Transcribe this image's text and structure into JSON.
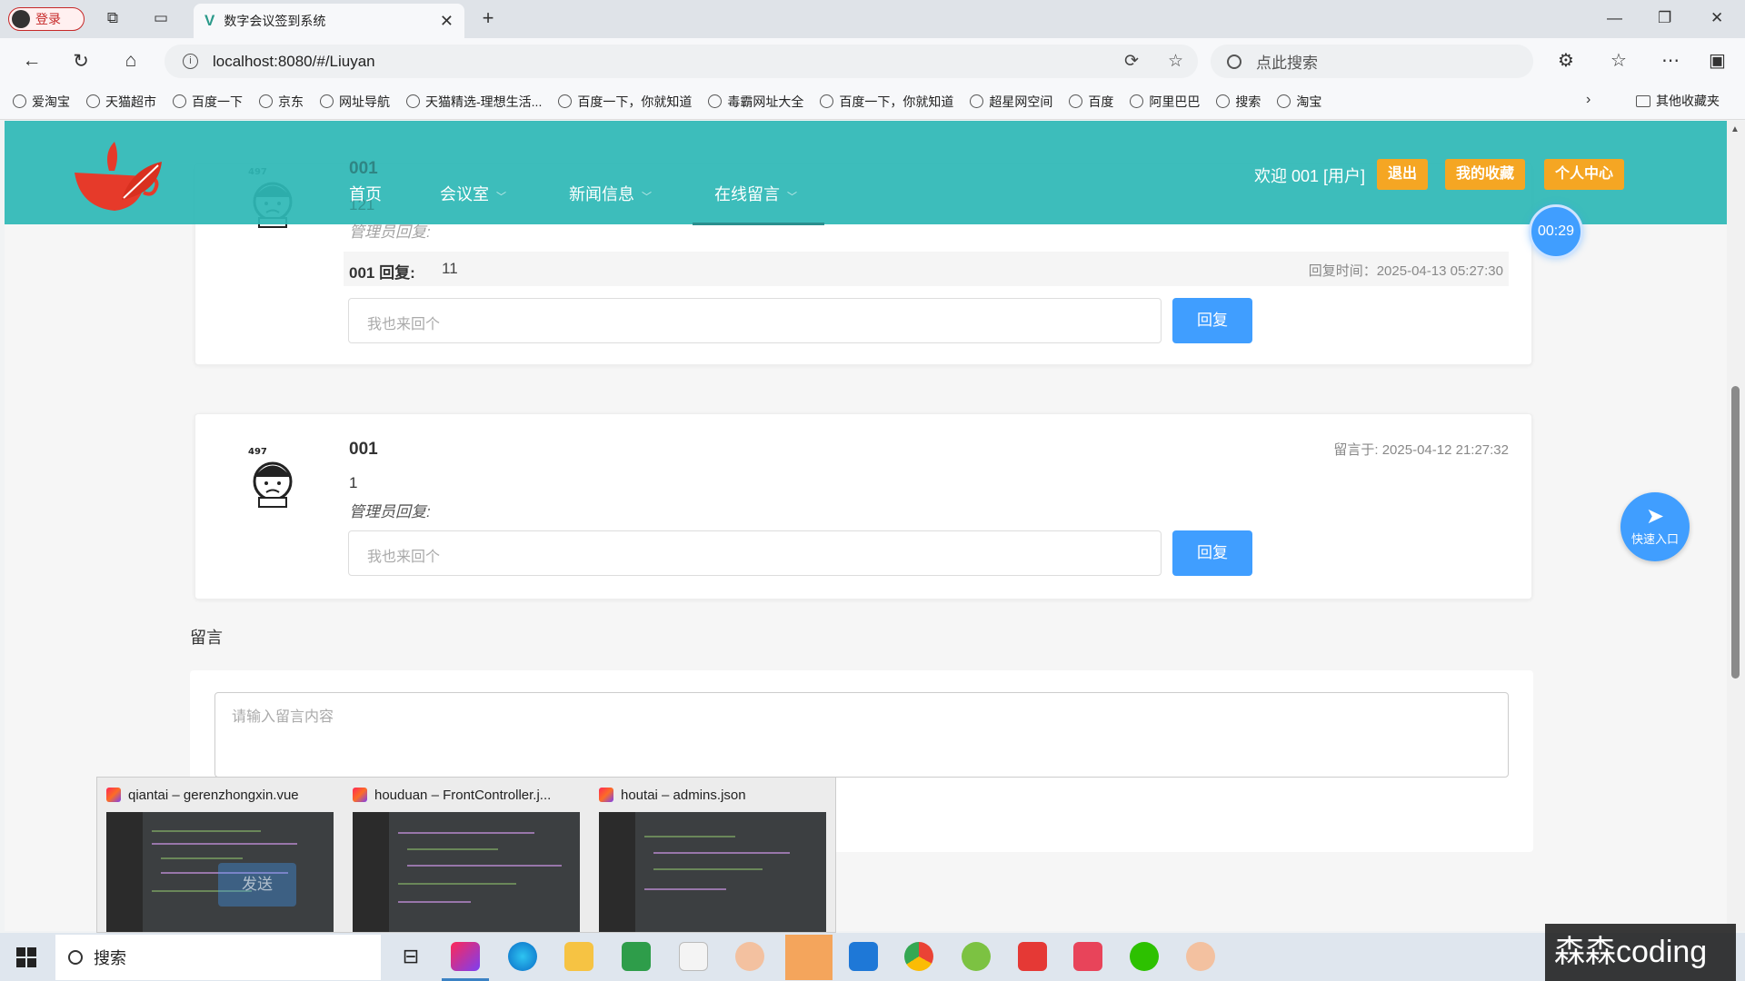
{
  "browser": {
    "profile_label": "登录",
    "tab_title": "数字会议签到系统",
    "url": "localhost:8080/#/Liuyan",
    "search_placeholder": "点此搜索",
    "bookmarks": [
      "爱淘宝",
      "天猫超市",
      "百度一下",
      "京东",
      "网址导航",
      "天猫精选-理想生活...",
      "百度一下，你就知道",
      "毒霸网址大全",
      "百度一下，你就知道",
      "超星网空间",
      "百度",
      "阿里巴巴",
      "搜索",
      "淘宝"
    ],
    "other_bookmarks": "其他收藏夹"
  },
  "header": {
    "nav": [
      "首页",
      "会议室",
      "新闻信息",
      "在线留言"
    ],
    "welcome": "欢迎 001 [用户]",
    "logout": "退出",
    "favorites": "我的收藏",
    "profile": "个人中心"
  },
  "timer": "00:29",
  "quick_entry": "快速入口",
  "messages": [
    {
      "user": "001",
      "content": "121",
      "admin_reply_label": "管理员回复:",
      "reply_user": "001 回复:",
      "reply_text": "11",
      "reply_time": "回复时间：2025-04-13 05:27:30",
      "input_placeholder": "我也来回个",
      "reply_button": "回复"
    },
    {
      "user": "001",
      "time": "留言于: 2025-04-12 21:27:32",
      "content": "1",
      "admin_reply_label": "管理员回复:",
      "input_placeholder": "我也来回个",
      "reply_button": "回复"
    }
  ],
  "leave_message": {
    "label": "留言",
    "placeholder": "请输入留言内容",
    "send_button": "发送"
  },
  "taskbar_previews": [
    "qiantai – gerenzhongxin.vue",
    "houduan – FrontController.j...",
    "houtai – admins.json"
  ],
  "taskbar": {
    "search": "搜索"
  },
  "watermark": "森森coding"
}
